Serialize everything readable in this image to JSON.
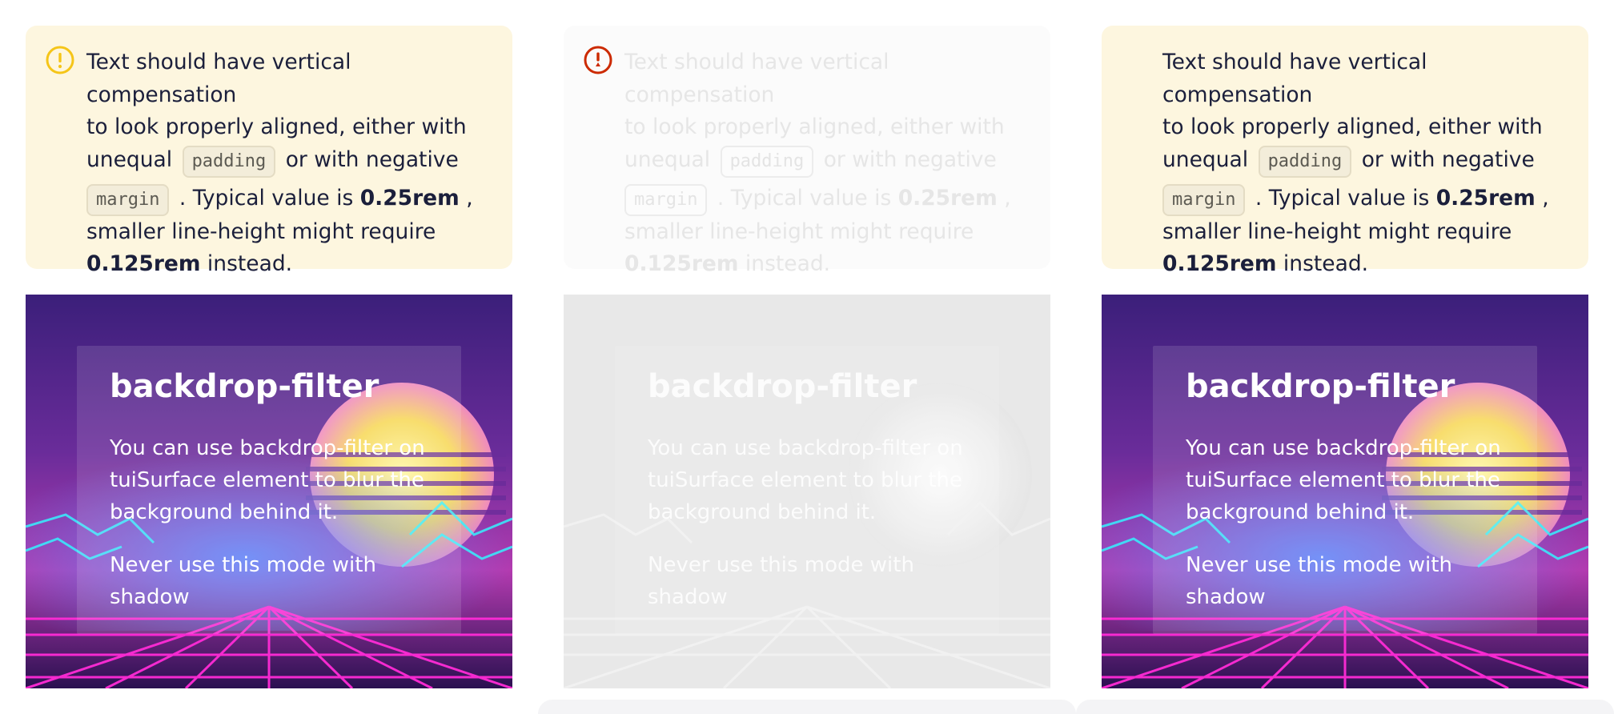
{
  "notice": {
    "lines": {
      "l1": "Text should have vertical compensation",
      "l2": "to look properly aligned, either with",
      "l3_prefix": "unequal",
      "code_padding": "padding",
      "l3_suffix": "or with negative",
      "code_margin": "margin",
      "l4_mid": ". Typical value is",
      "value_1": "0.25rem",
      "l4_end": ",",
      "l5": "smaller line-height might require",
      "value_2": "0.125rem",
      "l6_end": "instead."
    }
  },
  "card": {
    "title": "backdrop-filter",
    "para1": "You can use backdrop-filter on tuiSurface element to blur the background behind it.",
    "para2": "Never use this mode with shadow"
  },
  "icons": {
    "warning": "warning-circle-icon",
    "error": "error-circle-icon"
  },
  "colors": {
    "warning": "#f5c518",
    "error": "#cc2a00",
    "notice_bg": "#fdf6df"
  }
}
